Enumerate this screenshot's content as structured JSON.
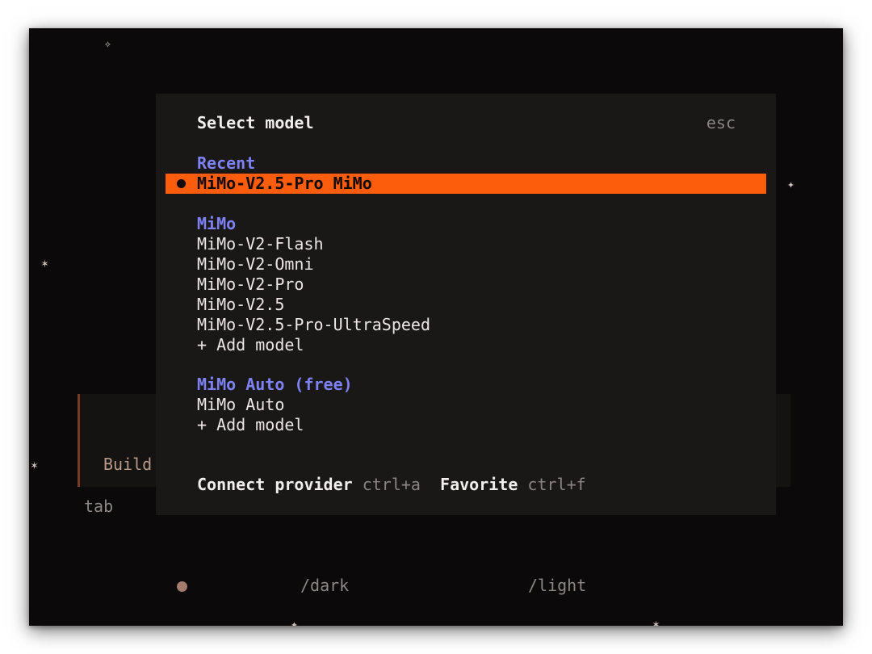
{
  "background": {
    "decorations": {
      "sparkle_top": "✧",
      "asterisk": "✶",
      "sparkle_right": "✦"
    },
    "build_label": "Build",
    "tab_label": "tab",
    "dark_command": "/dark",
    "light_command": "/light"
  },
  "dialog": {
    "title": "Select model",
    "close_hint": "esc",
    "recent": {
      "heading": "Recent",
      "selected": "MiMo-V2.5-Pro MiMo"
    },
    "mimo": {
      "heading": "MiMo",
      "models": [
        "MiMo-V2-Flash",
        "MiMo-V2-Omni",
        "MiMo-V2-Pro",
        "MiMo-V2.5",
        "MiMo-V2.5-Pro-UltraSpeed"
      ],
      "add_model": "+ Add model"
    },
    "mimo_auto": {
      "heading": "MiMo Auto (free)",
      "models": [
        "MiMo Auto"
      ],
      "add_model": "+ Add model"
    },
    "footer": {
      "connect_label": "Connect provider",
      "connect_key": "ctrl+a",
      "favorite_label": "Favorite",
      "favorite_key": "ctrl+f"
    }
  },
  "colors": {
    "accent": "#fb5d0d",
    "group_heading": "#7d81f4",
    "background": "#0b0909",
    "dialog": "#1a1717"
  }
}
